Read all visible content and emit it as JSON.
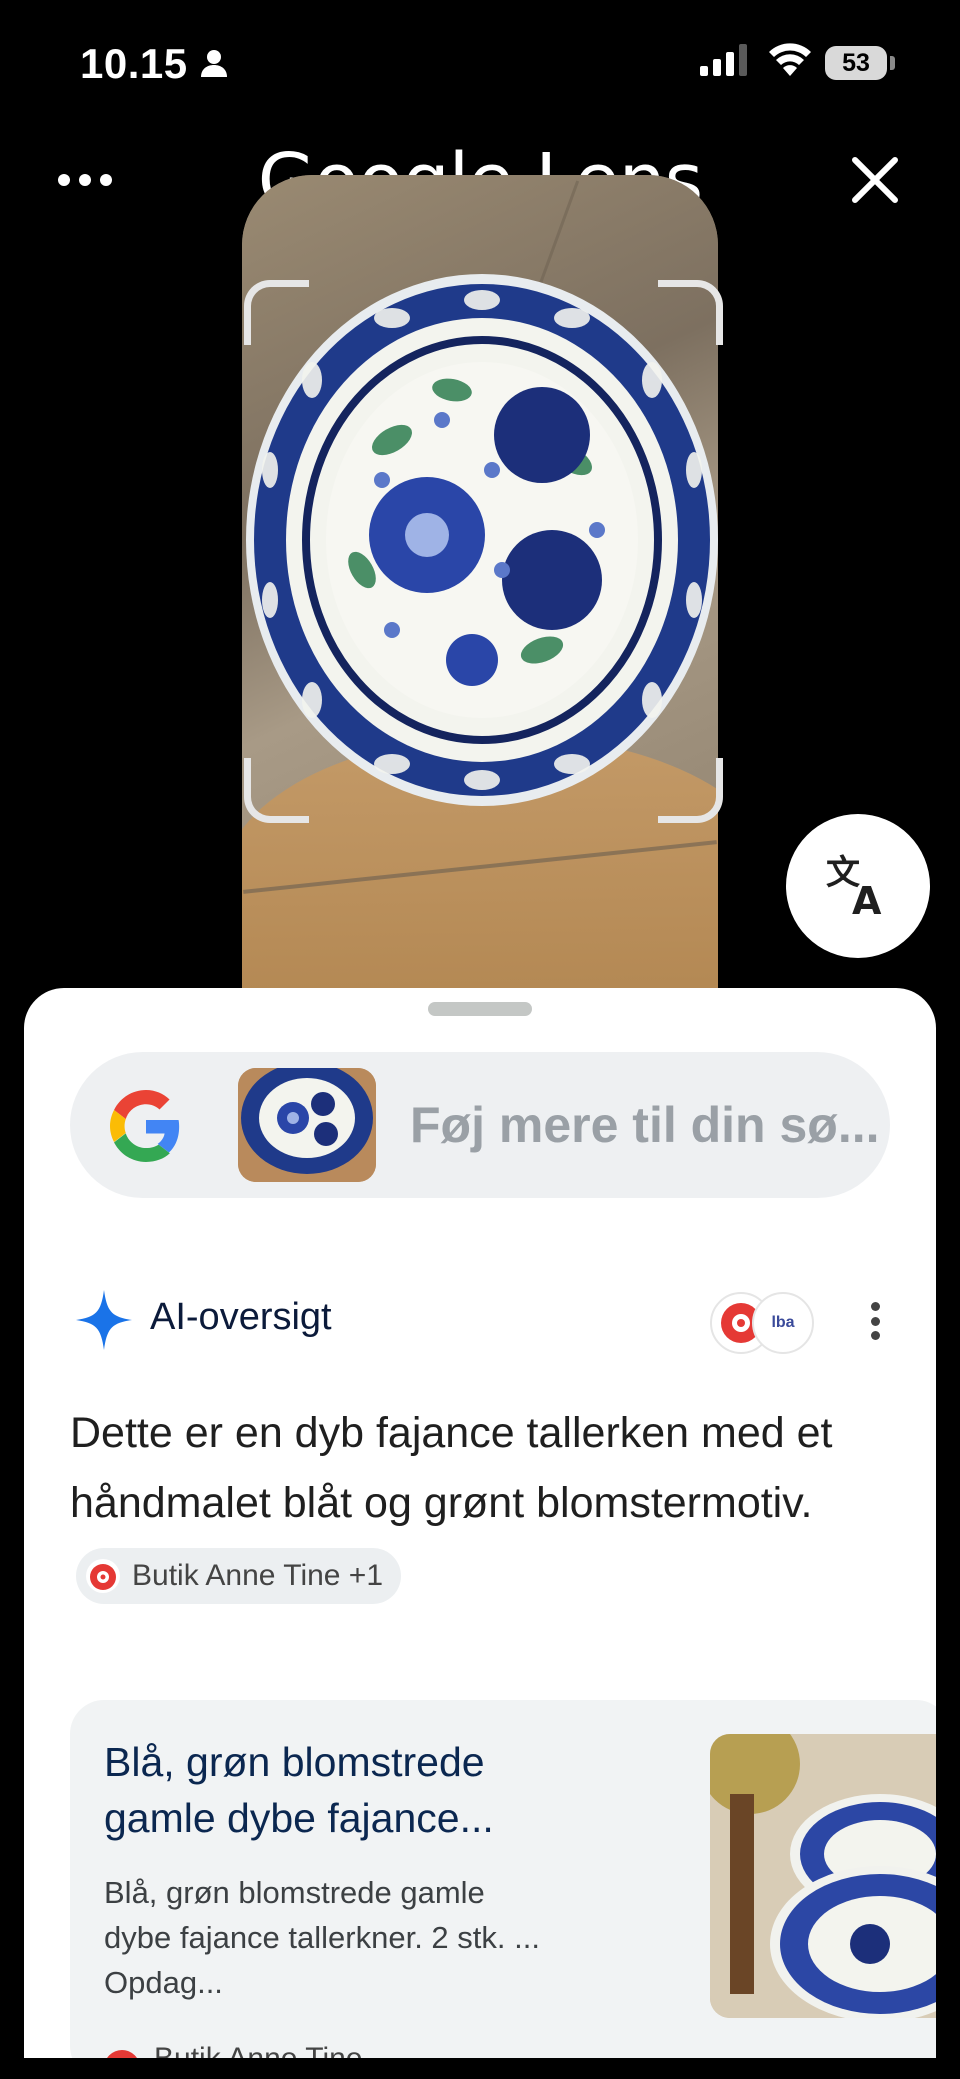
{
  "status_bar": {
    "time": "10.15",
    "battery": "53"
  },
  "header": {
    "title": "Google Lens"
  },
  "search": {
    "placeholder": "Føj mere til din sø..."
  },
  "ai_overview": {
    "title": "AI-oversigt",
    "source_badge_text": "lba",
    "text": "Dette er en dyb fajance tallerken med et håndmalet blåt og grønt blomstermotiv.",
    "citation": "Butik Anne Tine +1"
  },
  "result": {
    "title": "Blå, grøn blomstrede gamle dybe fajance...",
    "description": "Blå, grøn blomstrede gamle dybe fajance tallerkner. 2 stk. ... Opdag...",
    "source": "Butik Anne Tine"
  },
  "colors": {
    "accent_blue": "#1a73e8",
    "sheet_bg": "#ffffff",
    "pill_bg": "#eef0f2"
  },
  "icons": [
    "person-icon",
    "signal-icon",
    "wifi-icon",
    "battery-icon",
    "more-horiz-icon",
    "close-icon",
    "translate-icon",
    "google-logo-icon",
    "sparkle-icon",
    "more-vert-icon"
  ]
}
